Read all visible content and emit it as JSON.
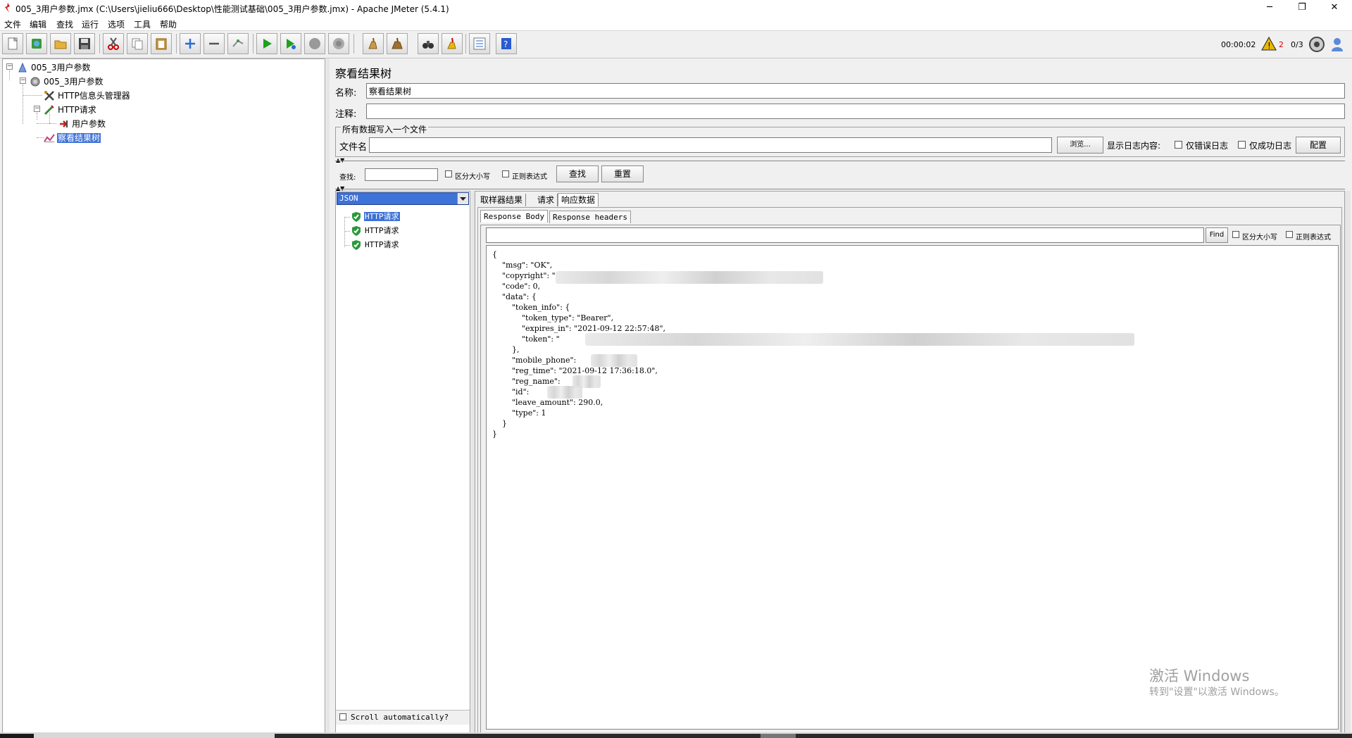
{
  "window": {
    "title": "005_3用户参数.jmx (C:\\Users\\jieliu666\\Desktop\\性能测试基础\\005_3用户参数.jmx) - Apache JMeter (5.4.1)",
    "minimize": "─",
    "maximize": "❐",
    "close": "✕"
  },
  "menu": [
    "文件",
    "编辑",
    "查找",
    "运行",
    "选项",
    "工具",
    "帮助"
  ],
  "status": {
    "elapsed": "00:00:02",
    "warnings": "2",
    "threads": "0/3"
  },
  "tree": {
    "items": [
      {
        "label": "005_3用户参数",
        "icon": "test-plan-icon"
      },
      {
        "label": "005_3用户参数",
        "icon": "thread-group-icon"
      },
      {
        "label": "HTTP信息头管理器",
        "icon": "header-manager-icon"
      },
      {
        "label": "HTTP请求",
        "icon": "http-sampler-icon"
      },
      {
        "label": "用户参数",
        "icon": "user-parameters-icon"
      },
      {
        "label": "察看结果树",
        "icon": "results-tree-icon"
      }
    ]
  },
  "panel": {
    "title": "察看结果树",
    "name_label": "名称:",
    "name_value": "察看结果树",
    "comment_label": "注释:",
    "comment_value": "",
    "file_group_label": "所有数据写入一个文件",
    "filename_label": "文件名",
    "filename_value": "",
    "browse_label": "浏览...",
    "log_display_label": "显示日志内容:",
    "errors_only_label": "仅错误日志",
    "success_only_label": "仅成功日志",
    "configure_label": "配置",
    "search_label": "查找:",
    "search_value": "",
    "case_sensitive_label": "区分大小写",
    "regex_label": "正则表达式",
    "search_button": "查找",
    "reset_button": "重置"
  },
  "results": {
    "renderer": "JSON",
    "samples": [
      "HTTP请求",
      "HTTP请求",
      "HTTP请求"
    ],
    "scroll_auto_label": "Scroll automatically?"
  },
  "detail": {
    "tabs": [
      "取样器结果",
      "请求",
      "响应数据"
    ],
    "subtabs": [
      "Response Body",
      "Response headers"
    ],
    "find_button": "Find",
    "case_sensitive_label": "区分大小写",
    "regex_label": "正则表达式",
    "json_lines": [
      "{",
      "    \"msg\": \"OK\",",
      "    \"copyright\": \"",
      "    \"code\": 0,",
      "    \"data\": {",
      "        \"token_info\": {",
      "            \"token_type\": \"Bearer\",",
      "            \"expires_in\": \"2021-09-12 22:57:48\",",
      "            \"token\": \"",
      "        },",
      "        \"mobile_phone\": ",
      "        \"reg_time\": \"2021-09-12 17:36:18.0\",",
      "        \"reg_name\": ",
      "        \"id\": ",
      "        \"leave_amount\": 290.0,",
      "        \"type\": 1",
      "    }",
      "}"
    ]
  },
  "watermark": {
    "line1": "激活 Windows",
    "line2": "转到\"设置\"以激活 Windows。"
  },
  "colors": {
    "selection": "#3d72d8",
    "pass_green": "#2a9a3a",
    "warning": "#e8b800"
  }
}
